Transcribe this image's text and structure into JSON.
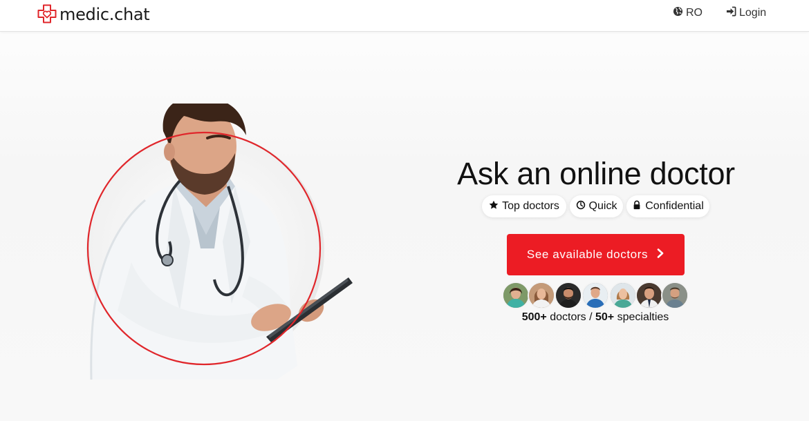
{
  "brand": {
    "name": "medic.chat",
    "logo_icon": "heart-cross-logo",
    "accent_color": "#e0262b"
  },
  "nav": {
    "language": {
      "label": "RO",
      "icon": "globe-icon"
    },
    "login": {
      "label": "Login",
      "icon": "sign-in-icon"
    }
  },
  "hero": {
    "title": "Ask an online doctor",
    "features": [
      {
        "label": "Top doctors",
        "icon": "star-icon"
      },
      {
        "label": "Quick",
        "icon": "clock-icon"
      },
      {
        "label": "Confidential",
        "icon": "lock-icon"
      }
    ],
    "cta": {
      "label": "See available doctors",
      "icon": "chevron-right-icon",
      "color": "#ec1c24"
    },
    "stats": {
      "doctors_count": "500+",
      "doctors_label": " doctors / ",
      "specialties_count": "50+",
      "specialties_label": " specialties"
    }
  }
}
